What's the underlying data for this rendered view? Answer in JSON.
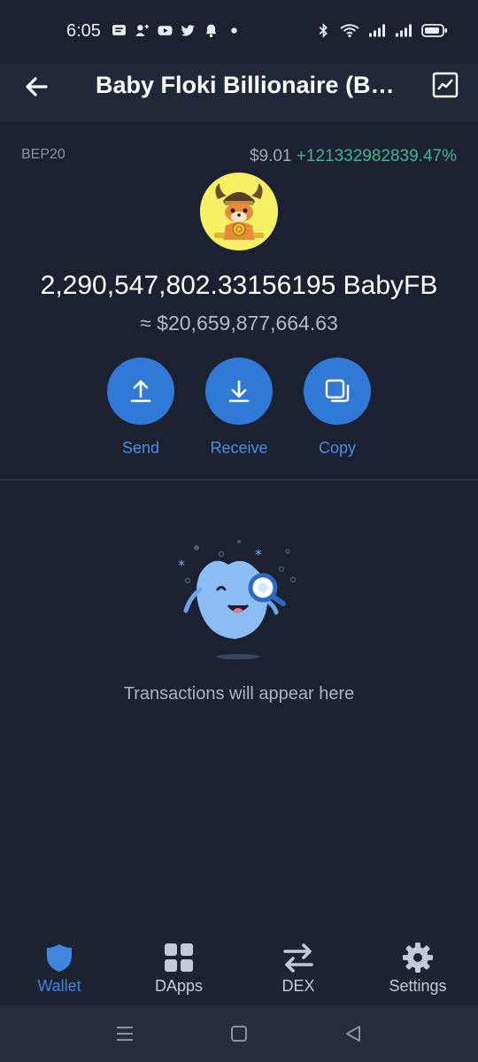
{
  "status": {
    "time": "6:05",
    "left_icons": [
      "message-icon",
      "add-contact-icon",
      "youtube-icon",
      "twitter-icon",
      "bell-icon",
      "dot-icon"
    ],
    "right_icons": [
      "bluetooth-icon",
      "wifi-icon",
      "signal-icon",
      "signal-icon",
      "battery-icon"
    ]
  },
  "header": {
    "title": "Baby Floki Billionaire (B…",
    "back_icon": "arrow-left-icon",
    "chart_icon": "chart-line-icon"
  },
  "token": {
    "network": "BEP20",
    "price": "$9.01",
    "change": "+121332982839.47%",
    "balance": "2,290,547,802.33156195 BabyFB",
    "fiat_value": "≈ $20,659,877,664.63",
    "colors": {
      "logo_bg": "#f6f065",
      "change": "#3fb98c",
      "accent": "#3179d6"
    }
  },
  "actions": [
    {
      "label": "Send",
      "icon": "upload-arrow-icon"
    },
    {
      "label": "Receive",
      "icon": "download-arrow-icon"
    },
    {
      "label": "Copy",
      "icon": "copy-icon"
    }
  ],
  "empty_state": {
    "message": "Transactions will appear here"
  },
  "nav": {
    "items": [
      {
        "label": "Wallet",
        "icon": "shield-icon",
        "active": true
      },
      {
        "label": "DApps",
        "icon": "grid-icon",
        "active": false
      },
      {
        "label": "DEX",
        "icon": "swap-arrows-icon",
        "active": false
      },
      {
        "label": "Settings",
        "icon": "gear-icon",
        "active": false
      }
    ]
  },
  "system_nav": [
    "menu-icon",
    "home-square-icon",
    "back-triangle-icon"
  ]
}
